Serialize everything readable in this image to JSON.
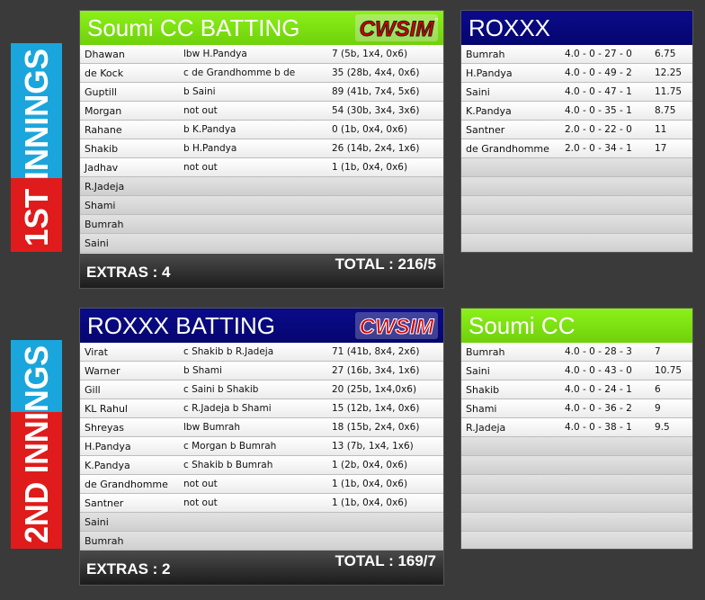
{
  "innings1": {
    "side_label": "1ST INNINGS",
    "batting": {
      "title": "Soumi CC BATTING",
      "logo_text": "CWSIM",
      "logo_tm": "™",
      "rows": [
        {
          "name": "Dhawan",
          "dismissal": "lbw H.Pandya",
          "score": "7 (5b, 1x4, 0x6)"
        },
        {
          "name": "de Kock",
          "dismissal": "c de Grandhomme b de",
          "score": "35 (28b, 4x4, 0x6)"
        },
        {
          "name": "Guptill",
          "dismissal": "b Saini",
          "score": "89 (41b, 7x4, 5x6)"
        },
        {
          "name": "Morgan",
          "dismissal": "not out",
          "score": "54 (30b, 3x4, 3x6)"
        },
        {
          "name": "Rahane",
          "dismissal": "b K.Pandya",
          "score": "0 (1b, 0x4, 0x6)"
        },
        {
          "name": "Shakib",
          "dismissal": "b H.Pandya",
          "score": "26 (14b, 2x4, 1x6)"
        },
        {
          "name": "Jadhav",
          "dismissal": "not out",
          "score": "1 (1b, 0x4, 0x6)"
        },
        {
          "name": "R.Jadeja",
          "dismissal": "",
          "score": ""
        },
        {
          "name": "Shami",
          "dismissal": "",
          "score": ""
        },
        {
          "name": "Bumrah",
          "dismissal": "",
          "score": ""
        },
        {
          "name": "Saini",
          "dismissal": "",
          "score": ""
        }
      ],
      "extras": "EXTRAS : 4",
      "total": "TOTAL : 216/5"
    },
    "bowling": {
      "title": "ROXXX",
      "rows": [
        {
          "name": "Bumrah",
          "figures": "4.0 - 0 - 27 - 0",
          "econ": "6.75"
        },
        {
          "name": "H.Pandya",
          "figures": "4.0 - 0 - 49 - 2",
          "econ": "12.25"
        },
        {
          "name": "Saini",
          "figures": "4.0 - 0 - 47 - 1",
          "econ": "11.75"
        },
        {
          "name": "K.Pandya",
          "figures": "4.0 - 0 - 35 - 1",
          "econ": "8.75"
        },
        {
          "name": "Santner",
          "figures": "2.0 - 0 - 22 - 0",
          "econ": "11"
        },
        {
          "name": "de Grandhomme",
          "figures": "2.0 - 0 - 34 - 1",
          "econ": "17"
        },
        {
          "name": "",
          "figures": "",
          "econ": ""
        },
        {
          "name": "",
          "figures": "",
          "econ": ""
        },
        {
          "name": "",
          "figures": "",
          "econ": ""
        },
        {
          "name": "",
          "figures": "",
          "econ": ""
        },
        {
          "name": "",
          "figures": "",
          "econ": ""
        }
      ]
    }
  },
  "innings2": {
    "side_label": "2ND INNINGS",
    "batting": {
      "title": "ROXXX BATTING",
      "logo_text": "CWSIM",
      "rows": [
        {
          "name": "Virat",
          "dismissal": "c Shakib b R.Jadeja",
          "score": "71 (41b, 8x4, 2x6)"
        },
        {
          "name": "Warner",
          "dismissal": "b Shami",
          "score": "27 (16b, 3x4, 1x6)"
        },
        {
          "name": "Gill",
          "dismissal": "c Saini b Shakib",
          "score": "20 (25b, 1x4,0x6)"
        },
        {
          "name": "KL Rahul",
          "dismissal": "c R.Jadeja b Shami",
          "score": "15 (12b, 1x4, 0x6)"
        },
        {
          "name": "Shreyas",
          "dismissal": "lbw Bumrah",
          "score": "18 (15b, 2x4, 0x6)"
        },
        {
          "name": "H.Pandya",
          "dismissal": "c Morgan b Bumrah",
          "score": "13 (7b, 1x4, 1x6)"
        },
        {
          "name": "K.Pandya",
          "dismissal": "c Shakib b Bumrah",
          "score": "1 (2b, 0x4, 0x6)"
        },
        {
          "name": "de Grandhomme",
          "dismissal": "not out",
          "score": "1 (1b, 0x4, 0x6)"
        },
        {
          "name": "Santner",
          "dismissal": "not out",
          "score": "1 (1b, 0x4, 0x6)"
        },
        {
          "name": "Saini",
          "dismissal": "",
          "score": ""
        },
        {
          "name": "Bumrah",
          "dismissal": "",
          "score": ""
        }
      ],
      "extras": "EXTRAS : 2",
      "total": "TOTAL : 169/7"
    },
    "bowling": {
      "title": "Soumi CC",
      "rows": [
        {
          "name": "Bumrah",
          "figures": "4.0 - 0 - 28 - 3",
          "econ": "7"
        },
        {
          "name": "Saini",
          "figures": "4.0 - 0 - 43 - 0",
          "econ": "10.75"
        },
        {
          "name": "Shakib",
          "figures": "4.0 - 0 - 24 - 1",
          "econ": "6"
        },
        {
          "name": "Shami",
          "figures": "4.0 - 0 - 36 - 2",
          "econ": "9"
        },
        {
          "name": "R.Jadeja",
          "figures": "4.0 - 0 - 38 - 1",
          "econ": "9.5"
        },
        {
          "name": "",
          "figures": "",
          "econ": ""
        },
        {
          "name": "",
          "figures": "",
          "econ": ""
        },
        {
          "name": "",
          "figures": "",
          "econ": ""
        },
        {
          "name": "",
          "figures": "",
          "econ": ""
        },
        {
          "name": "",
          "figures": "",
          "econ": ""
        },
        {
          "name": "",
          "figures": "",
          "econ": ""
        }
      ]
    }
  },
  "colors": {
    "green_header": "#7ee014",
    "blue_header": "#08087d",
    "side_red": "#e01b1b",
    "side_cyan": "#1aa6dc",
    "logo_red": "#d40000"
  }
}
